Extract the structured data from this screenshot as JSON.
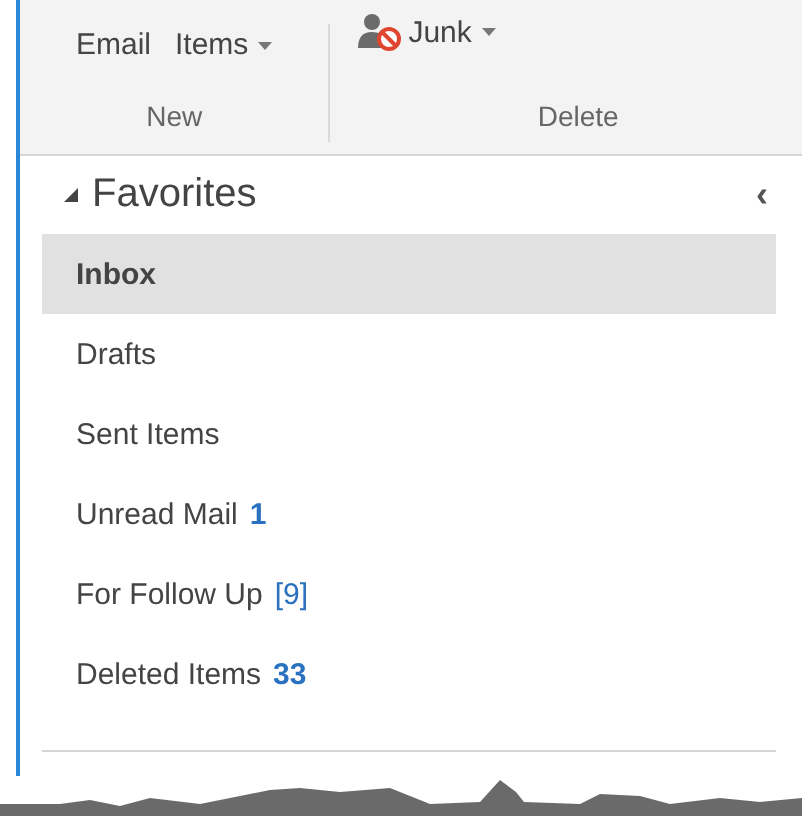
{
  "ribbon": {
    "groups": [
      {
        "label": "New",
        "buttons": [
          {
            "label": "Email",
            "dropdown": false
          },
          {
            "label": "Items",
            "dropdown": true
          }
        ]
      },
      {
        "label": "Delete",
        "buttons": [
          {
            "label": "Junk",
            "dropdown": true,
            "kind": "with_icon"
          }
        ]
      }
    ]
  },
  "favorites": {
    "title": "Favorites",
    "expanded": true,
    "collapse_glyph": "‹",
    "folders": [
      {
        "name": "Inbox",
        "selected": true
      },
      {
        "name": "Drafts",
        "selected": false
      },
      {
        "name": "Sent Items",
        "selected": false
      },
      {
        "name": "Unread Mail",
        "selected": false,
        "count": "1",
        "kind": "unread"
      },
      {
        "name": "For Follow Up",
        "selected": false,
        "count": "[9]",
        "kind": "search"
      },
      {
        "name": "Deleted Items",
        "selected": false,
        "count": "33",
        "kind": "unread"
      }
    ]
  }
}
